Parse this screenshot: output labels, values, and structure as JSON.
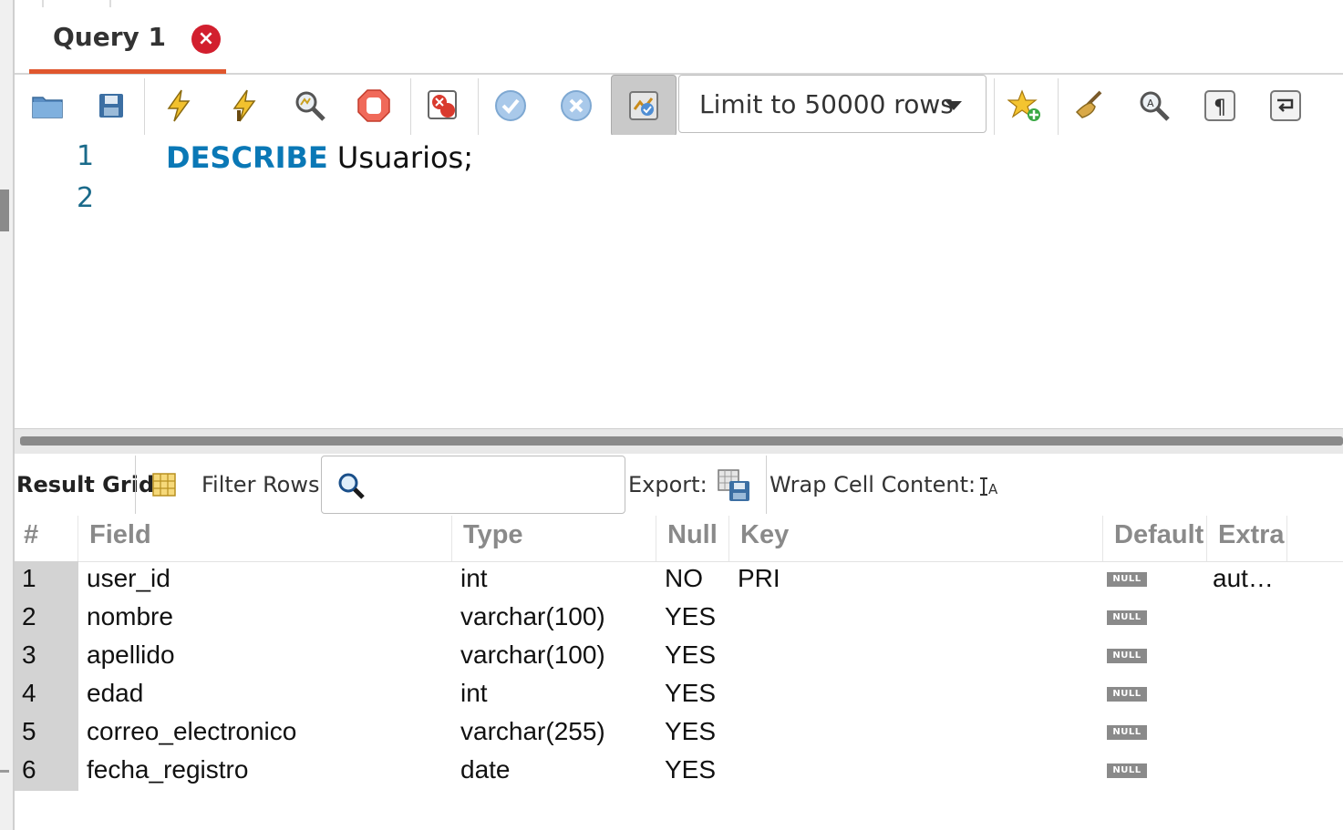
{
  "tabs": [
    {
      "label": "Query 1"
    }
  ],
  "toolbar": {
    "limit_label": "Limit to 50000 rows",
    "icons": [
      "open-folder-icon",
      "save-icon",
      "execute-icon",
      "execute-current-icon",
      "explain-icon",
      "stop-icon",
      "toggle-error-icon",
      "commit-icon",
      "rollback-icon",
      "autocommit-icon",
      "snippet-star-icon",
      "beautify-icon",
      "find-icon",
      "invisible-chars-icon",
      "wrap-lines-icon"
    ]
  },
  "editor": {
    "line_numbers": [
      "1",
      "2"
    ],
    "keyword": "DESCRIBE",
    "statement_rest": " Usuarios;"
  },
  "result_toolbar": {
    "result_grid_label": "Result Grid",
    "filter_label": "Filter Rows:",
    "filter_value": "",
    "export_label": "Export:",
    "wrap_label": "Wrap Cell Content:"
  },
  "grid": {
    "headers": {
      "num": "#",
      "field": "Field",
      "type": "Type",
      "null": "Null",
      "key": "Key",
      "default": "Default",
      "extra": "Extra"
    },
    "null_badge": "NULL",
    "rows": [
      {
        "num": "1",
        "field": "user_id",
        "type": "int",
        "null": "NO",
        "key": "PRI",
        "extra": "aut…"
      },
      {
        "num": "2",
        "field": "nombre",
        "type": "varchar(100)",
        "null": "YES",
        "key": "",
        "extra": ""
      },
      {
        "num": "3",
        "field": "apellido",
        "type": "varchar(100)",
        "null": "YES",
        "key": "",
        "extra": ""
      },
      {
        "num": "4",
        "field": "edad",
        "type": "int",
        "null": "YES",
        "key": "",
        "extra": ""
      },
      {
        "num": "5",
        "field": "correo_electronico",
        "type": "varchar(255)",
        "null": "YES",
        "key": "",
        "extra": ""
      },
      {
        "num": "6",
        "field": "fecha_registro",
        "type": "date",
        "null": "YES",
        "key": "",
        "extra": ""
      }
    ]
  },
  "colors": {
    "keyword": "#0a78b6",
    "tab_underline": "#e0572e",
    "close_button": "#d21f2e",
    "row_header": "#d3d3d3"
  }
}
